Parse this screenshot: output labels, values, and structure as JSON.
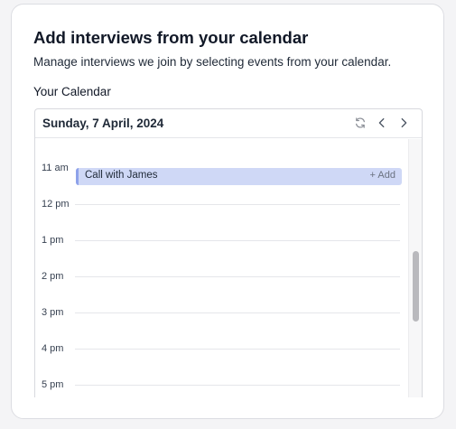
{
  "header": {
    "title": "Add interviews from your calendar",
    "subtitle": "Manage interviews we join by selecting events from your calendar."
  },
  "calendar": {
    "section_label": "Your Calendar",
    "date": "Sunday, 7 April, 2024",
    "icons": {
      "refresh": "refresh-icon",
      "previous": "chevron-left-icon",
      "next": "chevron-right-icon"
    },
    "hours": [
      "11 am",
      "12 pm",
      "1 pm",
      "2 pm",
      "3 pm",
      "4 pm",
      "5 pm"
    ],
    "event": {
      "title": "Call with James",
      "action": "+ Add",
      "color": "#cfd8f6",
      "accent": "#8ea2ea"
    }
  }
}
